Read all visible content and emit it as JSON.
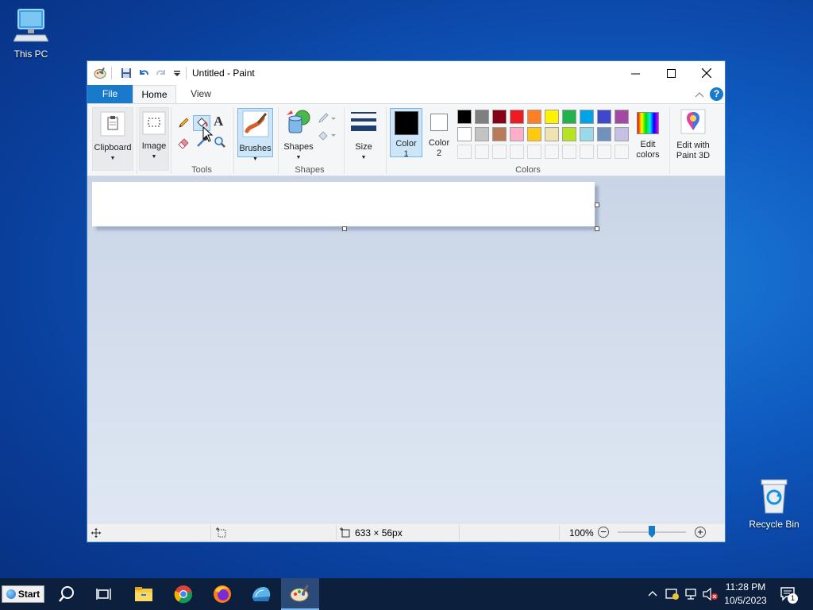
{
  "desktop": {
    "this_pc_label": "This PC",
    "recycle_bin_label": "Recycle Bin"
  },
  "window": {
    "title": "Untitled - Paint",
    "tabs": {
      "file": "File",
      "home": "Home",
      "view": "View"
    }
  },
  "ribbon": {
    "clipboard_label": "Clipboard",
    "image_label": "Image",
    "tools_group": "Tools",
    "brushes_label": "Brushes",
    "shapes_label": "Shapes",
    "shapes_group": "Shapes",
    "size_label": "Size",
    "color1_line1": "Color",
    "color1_line2": "1",
    "color2_line1": "Color",
    "color2_line2": "2",
    "colors_group": "Colors",
    "edit_colors_line1": "Edit",
    "edit_colors_line2": "colors",
    "paint3d_line1": "Edit with",
    "paint3d_line2": "Paint 3D",
    "palette_row1": [
      "#000000",
      "#7f7f7f",
      "#880015",
      "#ed1c24",
      "#ff7f27",
      "#fff200",
      "#22b14c",
      "#00a2e8",
      "#3f48cc",
      "#a349a4"
    ],
    "palette_row2": [
      "#ffffff",
      "#c3c3c3",
      "#b97a57",
      "#ffaec9",
      "#ffc90e",
      "#efe4b0",
      "#b5e61d",
      "#99d9ea",
      "#7092be",
      "#c8bfe7"
    ],
    "color1_value": "#000000",
    "color2_value": "#ffffff"
  },
  "statusbar": {
    "selection_size": "633 × 56px",
    "zoom_percent": "100%"
  },
  "taskbar": {
    "start_label": "Start",
    "time": "11:28 PM",
    "date": "10/5/2023",
    "notification_count": "1"
  }
}
